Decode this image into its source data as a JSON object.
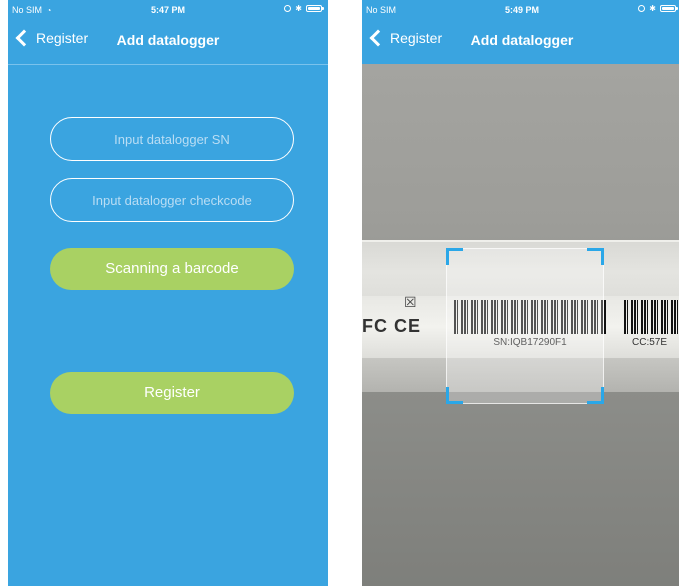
{
  "left_screen": {
    "status_bar": {
      "carrier": "No SIM",
      "wifi_icon": "wifi-icon",
      "time": "5:47 PM"
    },
    "nav": {
      "back_label": "Register",
      "title": "Add datalogger"
    },
    "form": {
      "sn_placeholder": "Input datalogger SN",
      "checkcode_placeholder": "Input datalogger checkcode",
      "scan_button": "Scanning a barcode",
      "register_button": "Register"
    },
    "colors": {
      "background": "#3aa4e0",
      "button": "#a9d163"
    }
  },
  "right_screen": {
    "status_bar": {
      "carrier": "No SIM",
      "time": "5:49 PM"
    },
    "nav": {
      "back_label": "Register",
      "title": "Add datalogger"
    },
    "camera": {
      "cert_marks": "FC CE",
      "barcode_sn": "SN:IQB17290F1",
      "cc_partial": "CC:57E",
      "frame_corner_color": "#2aa7e8"
    }
  }
}
